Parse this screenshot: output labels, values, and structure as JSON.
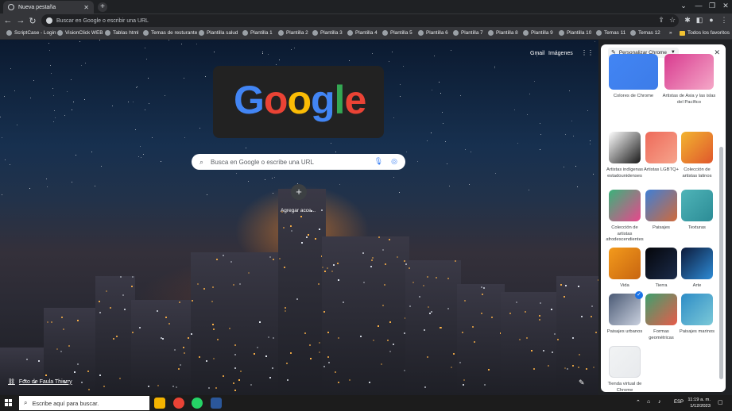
{
  "browser": {
    "tab_title": "Nueva pestaña",
    "new_tab": "+",
    "omnibox_placeholder": "Buscar en Google o escribir una URL",
    "bookmarks": [
      {
        "label": "ScriptCase - Login",
        "type": "site"
      },
      {
        "label": "VisionClick WEB",
        "type": "site"
      },
      {
        "label": "Tablas html",
        "type": "site"
      },
      {
        "label": "Temas de resturante",
        "type": "site"
      },
      {
        "label": "Plantilla salud",
        "type": "site"
      },
      {
        "label": "Plantilla 1",
        "type": "site"
      },
      {
        "label": "Plantilla 2",
        "type": "site"
      },
      {
        "label": "Plantilla 3",
        "type": "site"
      },
      {
        "label": "Plantilla 4",
        "type": "site"
      },
      {
        "label": "Plantilla 5",
        "type": "site"
      },
      {
        "label": "Plantilla 6",
        "type": "site"
      },
      {
        "label": "Plantilla 7",
        "type": "site"
      },
      {
        "label": "Plantilla 8",
        "type": "site"
      },
      {
        "label": "Plantilla 9",
        "type": "site"
      },
      {
        "label": "Plantilla 10",
        "type": "site"
      },
      {
        "label": "Temas 11",
        "type": "site"
      },
      {
        "label": "Temas 12",
        "type": "site"
      }
    ],
    "more_bookmarks": "»",
    "all_bookmarks": "Todos los favoritos"
  },
  "newtab": {
    "gmail": "Gmail",
    "images": "Imágenes",
    "search_placeholder": "Busca en Google o escribe una URL",
    "logo_text": "Google",
    "shortcut_label": "Agregar acce...",
    "photo_credit": "Foto de Faula Thierry"
  },
  "panel": {
    "title": "Personalizar Chrome",
    "items": [
      {
        "label": "Colores de Chrome",
        "colors": [
          "#4285f4",
          "#3d7ce8"
        ]
      },
      {
        "label": "Artistas de Asia y las islas del Pacífico",
        "colors": [
          "#d83a8f",
          "#f5a8c8"
        ]
      },
      {
        "label": "Artistas indígenas estadounidenses",
        "colors": [
          "#ffffff",
          "#1a1a1a"
        ]
      },
      {
        "label": "Artistas LGBTQ+",
        "colors": [
          "#ee6a5a",
          "#f6a48c"
        ]
      },
      {
        "label": "Colección de artistas latinos",
        "colors": [
          "#f2b430",
          "#e0572c"
        ]
      },
      {
        "label": "Colección de artistas afrodescendientes",
        "colors": [
          "#3ab27a",
          "#e8478c"
        ]
      },
      {
        "label": "Paisajes",
        "colors": [
          "#3f7fd6",
          "#d06a3b"
        ]
      },
      {
        "label": "Texturas",
        "colors": [
          "#4fb4b8",
          "#2c8c96"
        ]
      },
      {
        "label": "Vida",
        "colors": [
          "#f39a1c",
          "#c86510"
        ]
      },
      {
        "label": "Tierra",
        "colors": [
          "#05060a",
          "#1b2b4a"
        ]
      },
      {
        "label": "Arte",
        "colors": [
          "#0d1a3a",
          "#2d8bd6"
        ]
      },
      {
        "label": "Paisajes urbanos",
        "colors": [
          "#4b5a75",
          "#c9d0de"
        ]
      },
      {
        "label": "Formas geométricas",
        "colors": [
          "#3ea06e",
          "#e85b4a"
        ]
      },
      {
        "label": "Paisajes marinos",
        "colors": [
          "#2d8cc6",
          "#7cc9d8"
        ]
      },
      {
        "label": "Tienda virtual de Chrome",
        "colors": [
          "#f1f3f4",
          "#e8eaed"
        ]
      }
    ],
    "selected_index": 11
  },
  "taskbar": {
    "search_placeholder": "Escribe aquí para buscar.",
    "lang": "ESP",
    "time": "11:19 a. m.",
    "date": "1/12/2023"
  }
}
